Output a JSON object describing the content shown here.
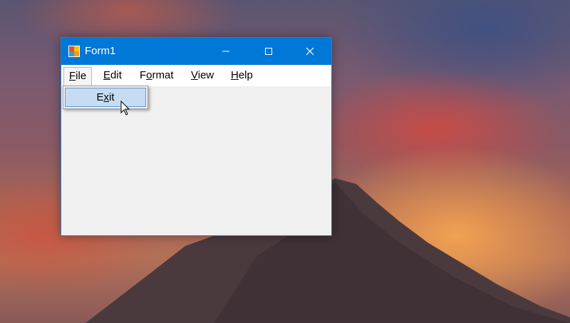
{
  "window": {
    "title": "Form1",
    "icon": "winforms-app-icon",
    "controls": {
      "minimize": "minimize-icon",
      "maximize": "maximize-icon",
      "close": "close-icon"
    }
  },
  "menubar": {
    "items": [
      {
        "label": "File",
        "mnemonic": "F",
        "rest": "ile",
        "state": "open"
      },
      {
        "label": "Edit",
        "mnemonic": "E",
        "rest": "dit"
      },
      {
        "label": "Format",
        "mnemonic": "o",
        "pre": "F",
        "rest": "rmat"
      },
      {
        "label": "View",
        "mnemonic": "V",
        "rest": "iew"
      },
      {
        "label": "Help",
        "mnemonic": "H",
        "rest": "elp"
      }
    ]
  },
  "dropdown": {
    "items": [
      {
        "label": "Exit",
        "pre": "E",
        "mnemonic": "x",
        "rest": "it",
        "state": "hovered"
      }
    ]
  },
  "colors": {
    "titlebar": "#0078d7",
    "menu_highlight": "#c6dcf3",
    "menu_highlight_border": "#5a9bd6",
    "client_bg": "#f0f0f0"
  }
}
